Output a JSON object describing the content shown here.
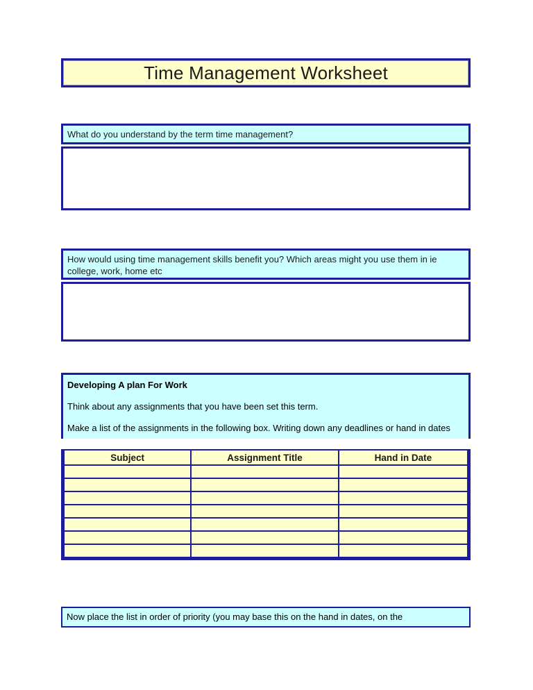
{
  "document": {
    "title": "Time Management Worksheet"
  },
  "questions": [
    {
      "prompt": "What do you understand by the term time management?",
      "answer": ""
    },
    {
      "prompt": "How would using time management skills benefit you? Which areas might you use them in ie college, work, home etc",
      "answer": ""
    }
  ],
  "plan_section": {
    "heading": "Developing A plan For Work",
    "paragraph_1": "Think about any assignments that you have been set this term.",
    "paragraph_2": "Make a list of the assignments in the following box. Writing down any deadlines or hand in dates",
    "table": {
      "columns": [
        "Subject",
        "Assignment Title",
        "Hand in Date"
      ],
      "rows": [
        [
          "",
          "",
          ""
        ],
        [
          "",
          "",
          ""
        ],
        [
          "",
          "",
          ""
        ],
        [
          "",
          "",
          ""
        ],
        [
          "",
          "",
          ""
        ],
        [
          "",
          "",
          ""
        ],
        [
          "",
          "",
          ""
        ]
      ]
    }
  },
  "bottom_prompt": {
    "text": "Now place the list in order of priority (you may base this on the hand in dates, on the"
  },
  "colors": {
    "border": "#1c1c9c",
    "prompt_fill": "#ccffff",
    "table_fill": "#ffffcc",
    "title_fill": "#ffffcc",
    "answer_fill": "#ffffff",
    "page": "#ffffff"
  }
}
